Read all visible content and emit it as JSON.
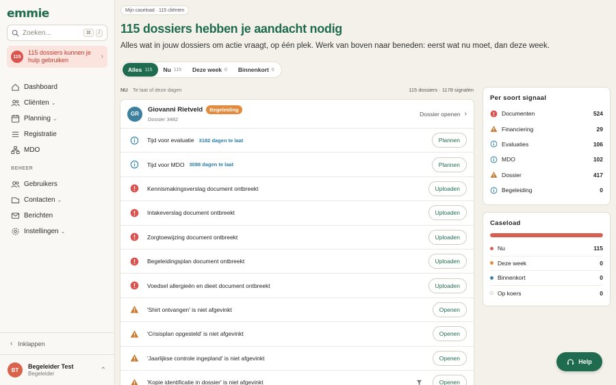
{
  "sidebar": {
    "logo": "emmie",
    "search_placeholder": "Zoeken...",
    "search_keys": [
      "⌘",
      "/"
    ],
    "alert_count": "115",
    "alert_text": "115 dossiers kunnen je hulp gebruiken",
    "nav": [
      {
        "label": "Dashboard",
        "icon": "home-icon"
      },
      {
        "label": "Cliënten",
        "icon": "users-icon",
        "has_caret": true
      },
      {
        "label": "Planning",
        "icon": "calendar-icon",
        "has_caret": true
      },
      {
        "label": "Registratie",
        "icon": "list-icon"
      },
      {
        "label": "MDO",
        "icon": "network-icon"
      }
    ],
    "section_beheer": "BEHEER",
    "beheer": [
      {
        "label": "Gebruikers",
        "icon": "users-icon"
      },
      {
        "label": "Contacten",
        "icon": "contacts-icon",
        "has_caret": true
      },
      {
        "label": "Berichten",
        "icon": "mail-icon"
      },
      {
        "label": "Instellingen",
        "icon": "gear-icon",
        "has_caret": true
      }
    ],
    "collapse_label": "Inklappen",
    "user": {
      "initials": "BT",
      "name": "Begeleider Test",
      "role": "Begeleider"
    }
  },
  "main": {
    "breadcrumb": "Mijn caseload · 115 cliënten",
    "title": "115 dossiers hebben je aandacht nodig",
    "subtitle": "Alles wat in jouw dossiers om actie vraagt, op één plek. Werk van boven naar beneden: eerst wat nu moet, dan deze week.",
    "tabs": [
      {
        "label": "Alles",
        "count": "115",
        "active": true
      },
      {
        "label": "Nu",
        "count": "115"
      },
      {
        "label": "Deze week",
        "count": "0"
      },
      {
        "label": "Binnenkort",
        "count": "0"
      }
    ],
    "list_header": {
      "section": "NU",
      "desc": "Te laat of deze dagen",
      "summary": "115 dossiers · 1178 signalen"
    },
    "client": {
      "initials": "GR",
      "name": "Giovanni Rietveld",
      "badge": "Begeleiding",
      "dossier": "Dossier 3482",
      "open_label": "Dossier openen"
    },
    "signals": [
      {
        "type": "info",
        "text": "Tijd voor evaluatie",
        "late": "3182 dagen te laat",
        "action": "Plannen"
      },
      {
        "type": "info",
        "text": "Tijd voor MDO",
        "late": "3088 dagen te laat",
        "action": "Plannen"
      },
      {
        "type": "error",
        "text": "Kennismakingsverslag document ontbreekt",
        "late": "",
        "action": "Uploaden"
      },
      {
        "type": "error",
        "text": "Intakeverslag document ontbreekt",
        "late": "",
        "action": "Uploaden"
      },
      {
        "type": "error",
        "text": "Zorgtoewijzing document ontbreekt",
        "late": "",
        "action": "Uploaden"
      },
      {
        "type": "error",
        "text": "Begeleidingsplan document ontbreekt",
        "late": "",
        "action": "Uploaden"
      },
      {
        "type": "error",
        "text": "Voedsel allergieën en dieet document ontbreekt",
        "late": "",
        "action": "Uploaden"
      },
      {
        "type": "warn",
        "text": "'Shirt ontvangen' is niet afgevinkt",
        "late": "",
        "action": "Openen"
      },
      {
        "type": "warn",
        "text": "'Crisisplan opgesteld' is niet afgevinkt",
        "late": "",
        "action": "Openen"
      },
      {
        "type": "warn",
        "text": "'Jaarlijkse controle ingepland' is niet afgevinkt",
        "late": "",
        "action": "Openen"
      },
      {
        "type": "warn",
        "text": "'Kopie identificatie in dossier' is niet afgevinkt",
        "late": "",
        "action": "Openen",
        "filter": true
      }
    ]
  },
  "signal_panel": {
    "title": "Per soort signaal",
    "items": [
      {
        "type": "error",
        "label": "Documenten",
        "value": "524"
      },
      {
        "type": "warn",
        "label": "Financiering",
        "value": "29"
      },
      {
        "type": "info",
        "label": "Evaluaties",
        "value": "106"
      },
      {
        "type": "info",
        "label": "MDO",
        "value": "102"
      },
      {
        "type": "warn",
        "label": "Dossier",
        "value": "417"
      },
      {
        "type": "info",
        "label": "Begeleiding",
        "value": "0"
      }
    ]
  },
  "caseload_panel": {
    "title": "Caseload",
    "progress_fraction": 1.0,
    "items": [
      {
        "label": "Nu",
        "value": "115",
        "color": "#d65f54"
      },
      {
        "label": "Deze week",
        "value": "0",
        "color": "#e58a3c"
      },
      {
        "label": "Binnenkort",
        "value": "0",
        "color": "#3c7f9e"
      },
      {
        "label": "Op koers",
        "value": "0",
        "color": "#dcd8cf"
      }
    ]
  },
  "help_label": "Help",
  "colors": {
    "brand": "#1f6b4f",
    "error": "#d9534f",
    "warn": "#c8792e",
    "info": "#2c7fa8"
  }
}
